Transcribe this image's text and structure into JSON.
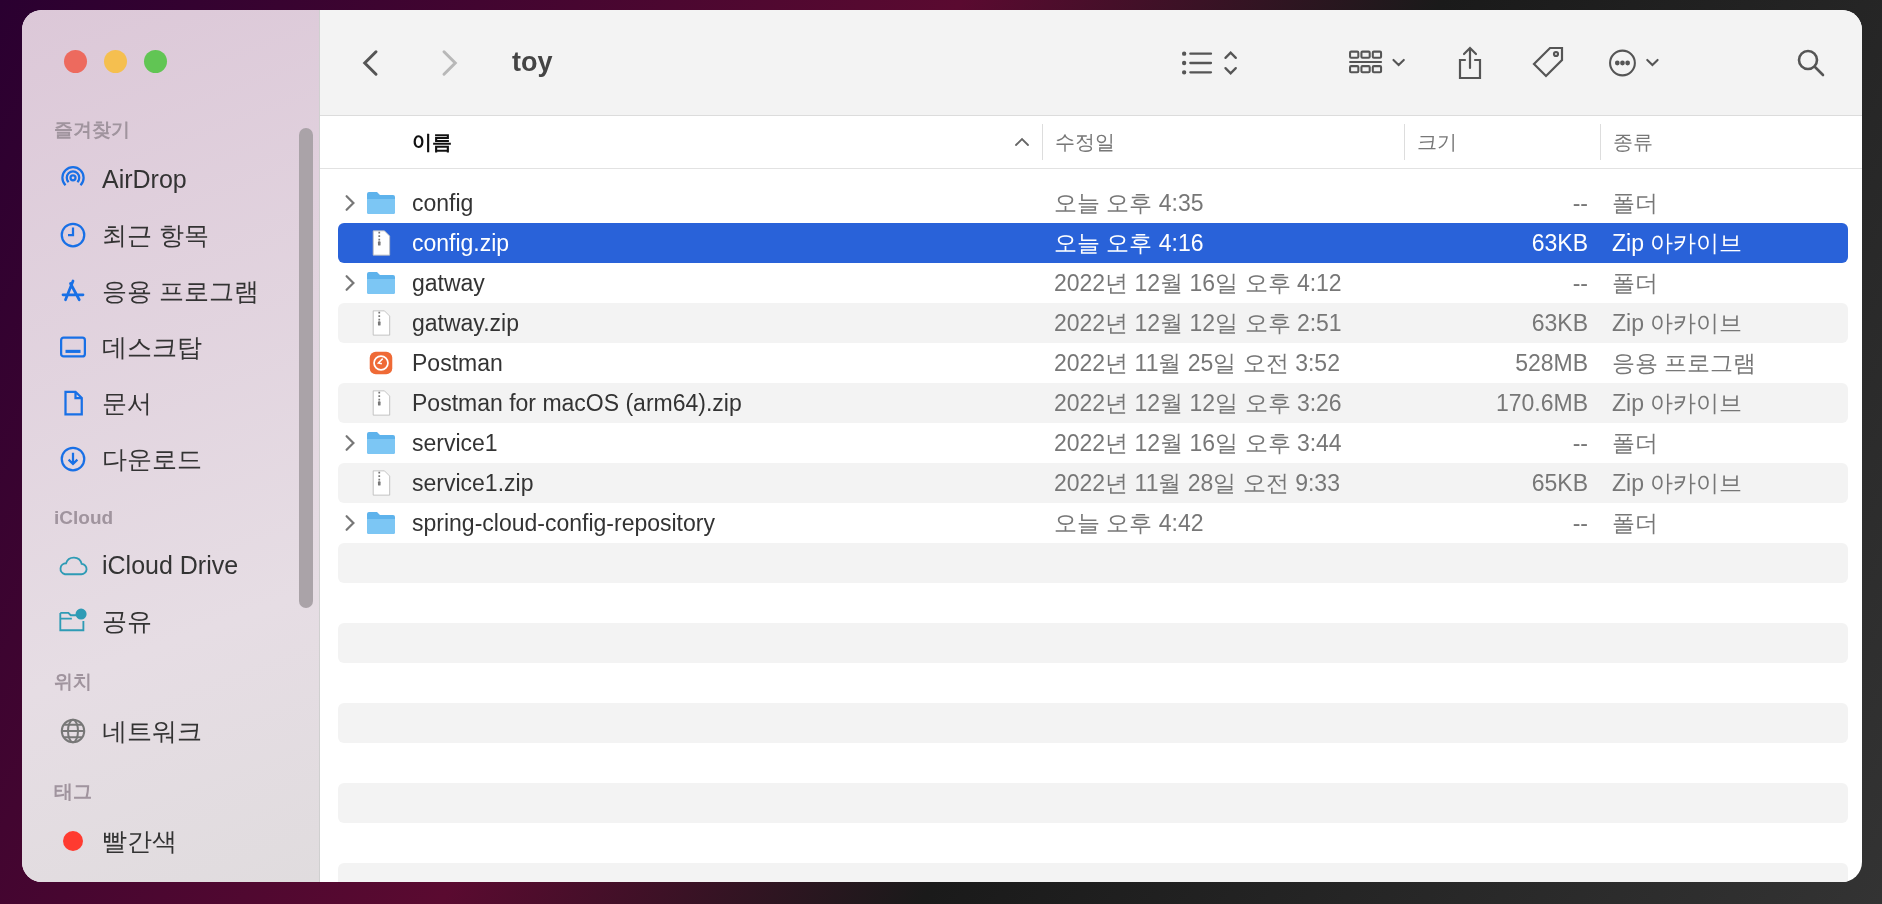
{
  "window": {
    "title": "toy"
  },
  "sidebar": {
    "sections": [
      {
        "title": "즐겨찾기",
        "items": [
          {
            "label": "AirDrop",
            "kind": "airdrop"
          },
          {
            "label": "최근 항목",
            "kind": "clock"
          },
          {
            "label": "응용 프로그램",
            "kind": "apps"
          },
          {
            "label": "데스크탑",
            "kind": "desktop"
          },
          {
            "label": "문서",
            "kind": "document"
          },
          {
            "label": "다운로드",
            "kind": "download"
          }
        ]
      },
      {
        "title": "iCloud",
        "items": [
          {
            "label": "iCloud Drive",
            "kind": "cloud"
          },
          {
            "label": "공유",
            "kind": "shared"
          }
        ]
      },
      {
        "title": "위치",
        "items": [
          {
            "label": "네트워크",
            "kind": "globe"
          }
        ]
      },
      {
        "title": "태그",
        "items": [
          {
            "label": "빨간색",
            "kind": "tag",
            "color": "#ff3b30"
          }
        ]
      }
    ]
  },
  "table": {
    "columns": [
      {
        "label": "이름",
        "sorted": true
      },
      {
        "label": "수정일",
        "sorted": false
      },
      {
        "label": "크기",
        "sorted": false
      },
      {
        "label": "종류",
        "sorted": false
      }
    ],
    "rows": [
      {
        "name": "config",
        "kind": "folder",
        "date": "오늘 오후 4:35",
        "size": "--",
        "type": "폴더",
        "selected": false
      },
      {
        "name": "config.zip",
        "kind": "zip",
        "date": "오늘 오후 4:16",
        "size": "63KB",
        "type": "Zip 아카이브",
        "selected": true
      },
      {
        "name": "gatway",
        "kind": "folder",
        "date": "2022년 12월 16일 오후 4:12",
        "size": "--",
        "type": "폴더",
        "selected": false
      },
      {
        "name": "gatway.zip",
        "kind": "zip",
        "date": "2022년 12월 12일 오후 2:51",
        "size": "63KB",
        "type": "Zip 아카이브",
        "selected": false
      },
      {
        "name": "Postman",
        "kind": "app",
        "date": "2022년 11월 25일 오전 3:52",
        "size": "528MB",
        "type": "응용 프로그램",
        "selected": false
      },
      {
        "name": "Postman for macOS (arm64).zip",
        "kind": "zip",
        "date": "2022년 12월 12일 오후 3:26",
        "size": "170.6MB",
        "type": "Zip 아카이브",
        "selected": false
      },
      {
        "name": "service1",
        "kind": "folder",
        "date": "2022년 12월 16일 오후 3:44",
        "size": "--",
        "type": "폴더",
        "selected": false
      },
      {
        "name": "service1.zip",
        "kind": "zip",
        "date": "2022년 11월 28일 오전 9:33",
        "size": "65KB",
        "type": "Zip 아카이브",
        "selected": false
      },
      {
        "name": "spring-cloud-config-repository",
        "kind": "folder",
        "date": "오늘 오후 4:42",
        "size": "--",
        "type": "폴더",
        "selected": false
      }
    ]
  }
}
